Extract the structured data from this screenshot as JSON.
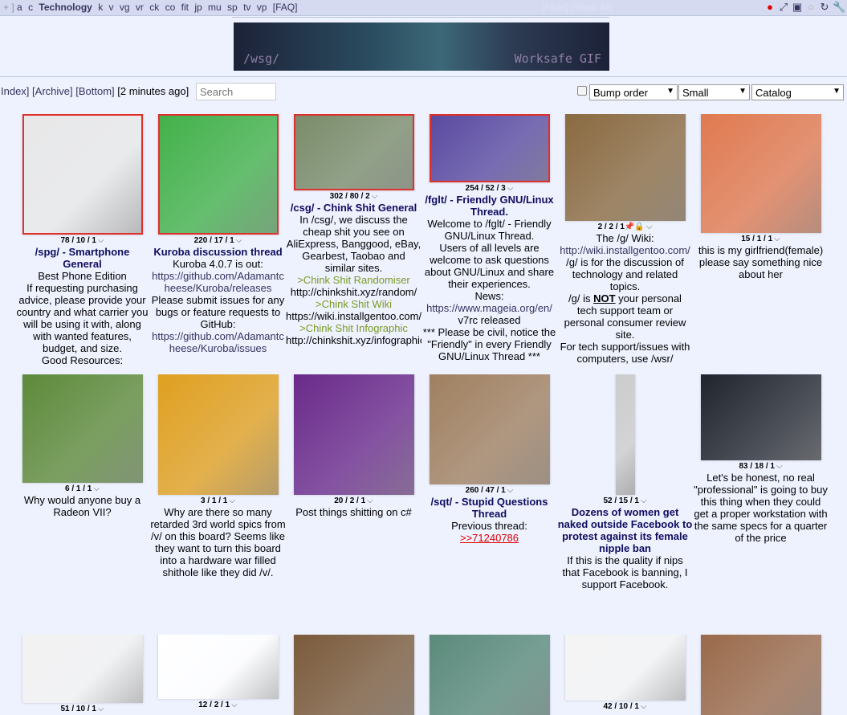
{
  "topbar": {
    "prefix": "+ ]",
    "boards": [
      "a",
      "c"
    ],
    "current": "Technology",
    "boards2": [
      "k",
      "v",
      "vg",
      "vr",
      "ck",
      "co",
      "fit",
      "jp",
      "mu",
      "sp",
      "tv",
      "vp"
    ],
    "faq": "[FAQ]",
    "faint": "[Hide] [Show All]",
    "icons": [
      "eye-icon",
      "expand-icon",
      "image-icon",
      "comment-icon",
      "refresh-icon",
      "wrench-icon"
    ],
    "icon_colors": {
      "eye": "#e00000"
    }
  },
  "banner": {
    "left": "/wsg/",
    "right": "Worksafe GIF"
  },
  "controls": {
    "index": "Index]",
    "archive": "[Archive]",
    "bottom": "[Bottom]",
    "updated": "[2 minutes ago]",
    "search_placeholder": "Search",
    "sort": "Bump order",
    "size": "Small",
    "mode": "Catalog"
  },
  "threads": [
    {
      "stats": "78 / 10 / 1",
      "highlight": true,
      "thumb": "#e8e8e8",
      "subject": "/spg/ - Smartphone General",
      "teaser": [
        [
          "t",
          "Best Phone Edition"
        ],
        [
          "t",
          "If requesting purchasing advice, please provide your country and what carrier you will be using it with, along with wanted features, budget, and size."
        ],
        [
          "t",
          "Good Resources:"
        ]
      ]
    },
    {
      "stats": "220 / 17 / 1",
      "highlight": true,
      "thumb": "#43b14a",
      "subject": "Kuroba discussion thread",
      "teaser": [
        [
          "t",
          "Kuroba 4.0.7 is out:"
        ],
        [
          "l",
          "https://github.com/Adamantcheese/Kuroba/releases"
        ],
        [
          "t",
          "Please submit issues for any bugs or feature requests to GitHub:"
        ],
        [
          "l",
          "https://github.com/Adamantcheese/Kuroba/issues"
        ]
      ]
    },
    {
      "stats": "302 / 80 / 2",
      "highlight": true,
      "thumb": "#7a8c6a",
      "subject": "/csg/ - Chink Shit General",
      "teaser": [
        [
          "t",
          "In /csg/, we discuss the cheap shit you see on AliExpress, Banggood, eBay, Gearbest, Taobao and similar sites."
        ],
        [
          "q",
          ">Chink Shit Randomiser"
        ],
        [
          "t",
          "http://chinkshit.xyz/random/"
        ],
        [
          "q",
          ">Chink Shit Wiki"
        ],
        [
          "t",
          "https://wiki.installgentoo.com/index.php/Chink_shit_general"
        ],
        [
          "q",
          ">Chink Shit Infographic"
        ],
        [
          "t",
          "http://chinkshit.xyz/infographic"
        ]
      ]
    },
    {
      "stats": "254 / 52 / 3",
      "highlight": true,
      "thumb": "#5a4aa0",
      "subject": "/fglt/ - Friendly GNU/Linux Thread.",
      "teaser": [
        [
          "t",
          "Welcome to /fglt/ - Friendly GNU/Linux Thread."
        ],
        [
          "t",
          "Users of all levels are welcome to ask questions about GNU/Linux and share their experiences."
        ],
        [
          "t",
          "News:"
        ],
        [
          "l",
          "https://www.mageia.org/en/"
        ],
        [
          "t",
          "v7rc released"
        ],
        [
          "t",
          "*** Please be civil, notice the \"Friendly\" in every Friendly GNU/Linux Thread ***"
        ]
      ]
    },
    {
      "stats": "2 / 2 / 1",
      "sticky": true,
      "thumb": "#8a6a40",
      "subject": "",
      "teaser": [
        [
          "t",
          "The /g/ Wiki:"
        ],
        [
          "l",
          "http://wiki.installgentoo.com/"
        ],
        [
          "t",
          "/g/ is for the discussion of technology and related topics."
        ],
        [
          "mix",
          "/g/ is |NOT| your personal tech support team or personal consumer review site."
        ],
        [
          "t",
          "For tech support/issues with computers, use /wsr/"
        ]
      ]
    },
    {
      "stats": "15 / 1 / 1",
      "thumb": "#e07a50",
      "subject": "",
      "teaser": [
        [
          "t",
          "this is my girlfriend(female) please say something nice about her"
        ]
      ]
    },
    {
      "stats": "6 / 1 / 1",
      "thumb": "#5e8a3a",
      "subject": "",
      "teaser": [
        [
          "t",
          "Why would anyone buy a Radeon VII?"
        ]
      ]
    },
    {
      "stats": "3 / 1 / 1",
      "thumb": "#e0a020",
      "subject": "",
      "teaser": [
        [
          "t",
          "Why are there so many retarded 3rd world spics from /v/ on this board? Seems like they want to turn this board into a hardware war filled shithole like they did /v/."
        ]
      ]
    },
    {
      "stats": "20 / 2 / 1",
      "thumb": "#6a2a8a",
      "subject": "",
      "teaser": [
        [
          "t",
          "Post things shitting on c#"
        ]
      ]
    },
    {
      "stats": "260 / 47 / 1",
      "thumb": "#a08060",
      "subject": "/sqt/ - Stupid Questions Thread",
      "teaser": [
        [
          "t",
          "Previous thread:"
        ],
        [
          "b",
          ">>71240786"
        ]
      ]
    },
    {
      "stats": "52 / 15 / 1",
      "thumb": "#cccccc",
      "narrow": true,
      "subject": "Dozens of women get naked outside Facebook to protest against its female nipple ban",
      "teaser": [
        [
          "t",
          "If this is the quality if nips that Facebook is banning, I support Facebook."
        ]
      ]
    },
    {
      "stats": "83 / 18 / 1",
      "thumb": "#20242c",
      "subject": "",
      "teaser": [
        [
          "t",
          "Let's be honest, no real \"professional\" is going to buy this thing when they could get a proper workstation with the same specs for a quarter of the price"
        ]
      ]
    },
    {
      "stats": "51 / 10 / 1",
      "thumb": "#f2f2f2",
      "subject": "",
      "teaser": []
    },
    {
      "stats": "12 / 2 / 1",
      "thumb": "#ffffff",
      "subject": "",
      "teaser": []
    },
    {
      "stats": "",
      "thumb": "#7a5a3a",
      "subject": "",
      "teaser": []
    },
    {
      "stats": "",
      "thumb": "#5a8a7a",
      "subject": "",
      "teaser": []
    },
    {
      "stats": "42 / 10 / 1",
      "thumb": "#f4f4f4",
      "subject": "",
      "teaser": []
    },
    {
      "stats": "",
      "thumb": "#9a6a4a",
      "subject": "",
      "teaser": []
    }
  ]
}
